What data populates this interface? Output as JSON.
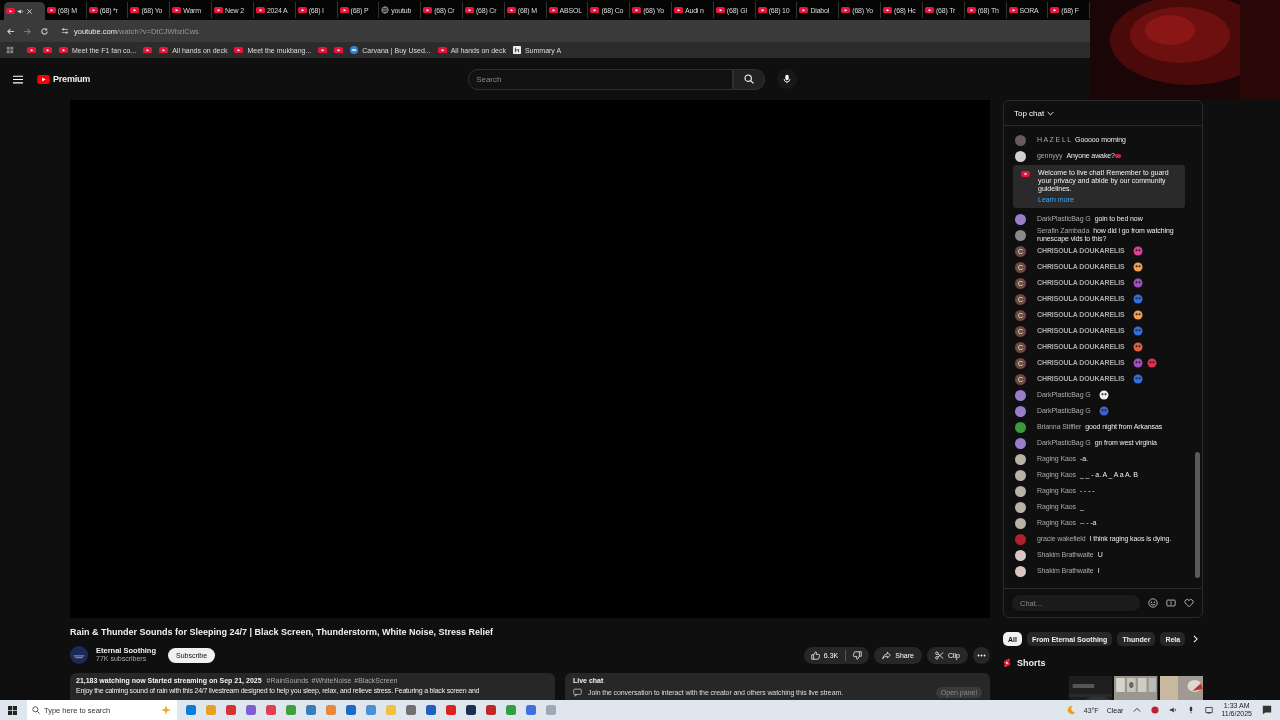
{
  "browser": {
    "tabs": [
      {
        "kind": "youtube",
        "selected": true,
        "audio": true
      },
      {
        "kind": "youtube",
        "title": "(68) M",
        "selected": false,
        "audio": false
      },
      {
        "kind": "youtube",
        "title": "(68) *r",
        "selected": false,
        "audio": false
      },
      {
        "kind": "youtube",
        "title": "(68) Yo",
        "selected": false,
        "audio": false
      },
      {
        "kind": "youtube",
        "title": "Warm",
        "selected": false,
        "audio": false
      },
      {
        "kind": "youtube",
        "title": "New 2",
        "selected": false,
        "audio": false
      },
      {
        "kind": "youtube",
        "title": "2024 A",
        "selected": false,
        "audio": false
      },
      {
        "kind": "youtube",
        "title": "(68) I",
        "selected": false,
        "audio": false
      },
      {
        "kind": "youtube",
        "title": "(68) P",
        "selected": false,
        "audio": false
      },
      {
        "kind": "globe",
        "title": "youtub",
        "selected": false,
        "audio": false
      },
      {
        "kind": "youtube",
        "title": "(68) Cr",
        "selected": false,
        "audio": false
      },
      {
        "kind": "youtube",
        "title": "(68) Cr",
        "selected": false,
        "audio": false
      },
      {
        "kind": "youtube",
        "title": "(68) M",
        "selected": false,
        "audio": false
      },
      {
        "kind": "youtube",
        "title": "ABSOL",
        "selected": false,
        "audio": false
      },
      {
        "kind": "youtube",
        "title": "(68) Co",
        "selected": false,
        "audio": false
      },
      {
        "kind": "youtube",
        "title": "(68) Yo",
        "selected": false,
        "audio": false
      },
      {
        "kind": "youtube",
        "title": "Audi n",
        "selected": false,
        "audio": false
      },
      {
        "kind": "youtube",
        "title": "(68) Gl",
        "selected": false,
        "audio": false
      },
      {
        "kind": "youtube",
        "title": "(68) 10",
        "selected": false,
        "audio": false
      },
      {
        "kind": "youtube",
        "title": "Diabol",
        "selected": false,
        "audio": false
      },
      {
        "kind": "youtube",
        "title": "(68) Yo",
        "selected": false,
        "audio": false
      },
      {
        "kind": "youtube",
        "title": "(68) Hc",
        "selected": false,
        "audio": false
      },
      {
        "kind": "youtube",
        "title": "(68) Tr",
        "selected": false,
        "audio": false
      },
      {
        "kind": "youtube",
        "title": "(68) Th",
        "selected": false,
        "audio": false
      },
      {
        "kind": "youtube",
        "title": "SORA",
        "selected": false,
        "audio": false
      },
      {
        "kind": "youtube",
        "title": "(68) F",
        "selected": false,
        "audio": false
      }
    ],
    "url_host": "youtube.com",
    "url_path": "/watch?v=DtCJWbzlCws",
    "bookmarks": [
      {
        "kind": "youtube"
      },
      {
        "kind": "youtube"
      },
      {
        "kind": "youtube",
        "label": "Meet the F1 fan co..."
      },
      {
        "kind": "youtube"
      },
      {
        "kind": "youtube",
        "label": "All hands on deck"
      },
      {
        "kind": "youtube",
        "label": "Meet the mukbang..."
      },
      {
        "kind": "youtube"
      },
      {
        "kind": "youtube"
      },
      {
        "kind": "carvana",
        "label": "Carvana | Buy Used..."
      },
      {
        "kind": "youtube",
        "label": "All hands on deck"
      },
      {
        "kind": "summary",
        "label": "Summary A"
      }
    ]
  },
  "header": {
    "logo": "Premium",
    "search_placeholder": "Search"
  },
  "video": {
    "title": "Rain & Thunder Sounds for Sleeping 24/7 | Black Screen, Thunderstorm, White Noise, Stress Relief",
    "channel": "Eternal Soothing",
    "subscribers": "77K subscribers",
    "subscribe": "Subscribe",
    "likes": "6.3K",
    "share": "Share",
    "clip": "Clip",
    "stats": "21,183 watching now  Started streaming on Sep 21, 2025",
    "hashtags": [
      "#RainSounds",
      "#WhiteNoise",
      "#BlackScreen"
    ],
    "description": "Enjoy the calming sound of rain with this 24/7 livestream designed to help you sleep, relax, and relieve stress. Featuring a black screen and"
  },
  "live_chat_box": {
    "title": "Live chat",
    "text": "Join the conversation to interact with the creator and others watching this live stream.",
    "button": "Open panel"
  },
  "chat": {
    "mode": "Top chat",
    "placeholder": "Chat...",
    "messages": [
      {
        "kind": "text",
        "author": "H A Z E L L",
        "avatar": {
          "color": "#6a5a5e"
        },
        "message": "Gooooo morning"
      },
      {
        "kind": "text",
        "author": "gennyyy",
        "badge": true,
        "avatar": {
          "color": "#d0d0d0"
        },
        "message": "Anyone awake?"
      },
      {
        "kind": "notice",
        "text": "Welcome to live chat! Remember to guard your privacy and abide by our community guidelines.",
        "link": "Learn more"
      },
      {
        "kind": "text",
        "author": "DarkPlasticBag G",
        "avatar": {
          "color": "#9a7fc8"
        },
        "message": "goin to bed now"
      },
      {
        "kind": "text",
        "author": "Serafin Zambada",
        "avatar": {
          "color": "#8a8a8a"
        },
        "message": "how did i go from watching runescape vids to this?"
      },
      {
        "kind": "emotes",
        "author": "CHRISOULA DOUKARELIS",
        "avatar": {
          "color": "#6b4a42",
          "letter": "C"
        },
        "emotes": [
          {
            "color": "#e0409a"
          }
        ]
      },
      {
        "kind": "emotes",
        "author": "CHRISOULA DOUKARELIS",
        "avatar": {
          "color": "#6b4a42",
          "letter": "C"
        },
        "emotes": [
          {
            "color": "#f0a050"
          }
        ]
      },
      {
        "kind": "emotes",
        "author": "CHRISOULA DOUKARELIS",
        "avatar": {
          "color": "#6b4a42",
          "letter": "C"
        },
        "emotes": [
          {
            "color": "#a050c0"
          }
        ]
      },
      {
        "kind": "emotes",
        "author": "CHRISOULA DOUKARELIS",
        "avatar": {
          "color": "#6b4a42",
          "letter": "C"
        },
        "emotes": [
          {
            "color": "#3070e0"
          }
        ]
      },
      {
        "kind": "emotes",
        "author": "CHRISOULA DOUKARELIS",
        "avatar": {
          "color": "#6b4a42",
          "letter": "C"
        },
        "emotes": [
          {
            "color": "#f0a050"
          }
        ]
      },
      {
        "kind": "emotes",
        "author": "CHRISOULA DOUKARELIS",
        "avatar": {
          "color": "#6b4a42",
          "letter": "C"
        },
        "emotes": [
          {
            "color": "#3070e0"
          }
        ]
      },
      {
        "kind": "emotes",
        "author": "CHRISOULA DOUKARELIS",
        "avatar": {
          "color": "#6b4a42",
          "letter": "C"
        },
        "emotes": [
          {
            "color": "#e06040"
          }
        ]
      },
      {
        "kind": "emotes",
        "author": "CHRISOULA DOUKARELIS",
        "avatar": {
          "color": "#6b4a42",
          "letter": "C"
        },
        "emotes": [
          {
            "color": "#a050c0"
          },
          {
            "color": "#e03050"
          }
        ]
      },
      {
        "kind": "emotes",
        "author": "CHRISOULA DOUKARELIS",
        "avatar": {
          "color": "#6b4a42",
          "letter": "C"
        },
        "emotes": [
          {
            "color": "#3070e0"
          }
        ]
      },
      {
        "kind": "emotes",
        "author": "DarkPlasticBag G",
        "avatar": {
          "color": "#9a7fc8"
        },
        "emotes": [
          {
            "color": "#f0f0f0"
          }
        ]
      },
      {
        "kind": "emotes",
        "author": "DarkPlasticBag G",
        "avatar": {
          "color": "#9a7fc8"
        },
        "emotes": [
          {
            "color": "#4060d0"
          }
        ]
      },
      {
        "kind": "text",
        "author": "Brianna Stiffler",
        "avatar": {
          "color": "#3a9a40"
        },
        "message": "good night from Arkansas"
      },
      {
        "kind": "text",
        "author": "DarkPlasticBag G",
        "avatar": {
          "color": "#9a7fc8"
        },
        "message": "gn from west virginia"
      },
      {
        "kind": "text",
        "author": "Raging Kaos",
        "avatar": {
          "color": "#b8b2a4"
        },
        "message": "-a."
      },
      {
        "kind": "text",
        "author": "Raging Kaos",
        "avatar": {
          "color": "#b8b2a4"
        },
        "message": "_ _ - a. A _ A a A. B"
      },
      {
        "kind": "text",
        "author": "Raging Kaos",
        "avatar": {
          "color": "#b8b2a4"
        },
        "message": "- - - -"
      },
      {
        "kind": "text",
        "author": "Raging Kaos",
        "avatar": {
          "color": "#b8b2a4"
        },
        "message": "_"
      },
      {
        "kind": "text",
        "author": "Raging Kaos",
        "avatar": {
          "color": "#b8b2a4"
        },
        "message": "-- - -a"
      },
      {
        "kind": "text",
        "author": "gracie wakefield",
        "avatar": {
          "color": "#b02030"
        },
        "message": "I think raging kaos is dying."
      },
      {
        "kind": "text",
        "author": "Shakim Brathwaite",
        "avatar": {
          "color": "#d8c8c0"
        },
        "message": "U"
      },
      {
        "kind": "text",
        "author": "Shakim Brathwaite",
        "avatar": {
          "color": "#d8c8c0"
        },
        "message": "I"
      }
    ]
  },
  "chips": [
    {
      "label": "All",
      "selected": true
    },
    {
      "label": "From Eternal Soothing",
      "selected": false
    },
    {
      "label": "Thunder",
      "selected": false
    },
    {
      "label": "Rela",
      "selected": false
    }
  ],
  "shorts": {
    "title": "Shorts"
  },
  "taskbar": {
    "search_placeholder": "Type here to search",
    "temperature": "43°F",
    "weather": "Clear",
    "time": "1:33 AM",
    "date": "11/6/2025"
  }
}
